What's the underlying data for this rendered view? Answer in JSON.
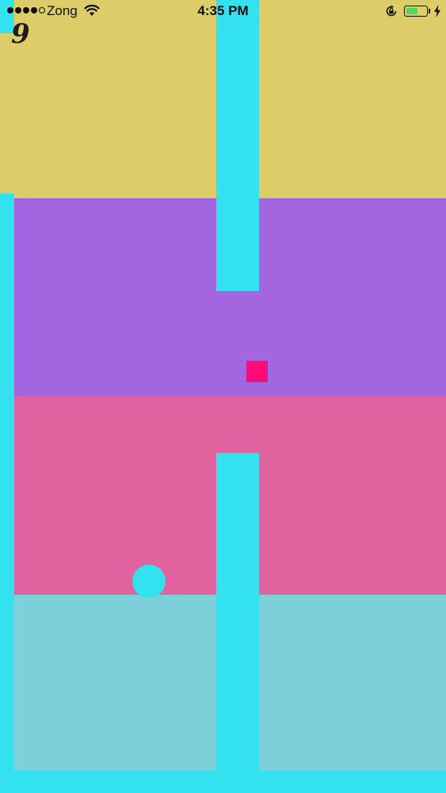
{
  "status_bar": {
    "signal_bars_filled": 4,
    "signal_bars_total": 5,
    "carrier": "Zong",
    "time": "4:35 PM",
    "battery_level_percent": 60,
    "icons": [
      "wifi-icon",
      "rotation-lock-icon",
      "battery-icon",
      "charging-icon"
    ]
  },
  "game": {
    "score": "9"
  },
  "colors": {
    "band_yellow": "#dccd68",
    "band_purple": "#a466e0",
    "band_pink": "#e0629f",
    "band_teal": "#7dcfda",
    "obstacle_cyan": "#34e1ef",
    "player_square": "#ff0a79",
    "ball": "#34e1ef",
    "battery_green": "#4cd964"
  }
}
